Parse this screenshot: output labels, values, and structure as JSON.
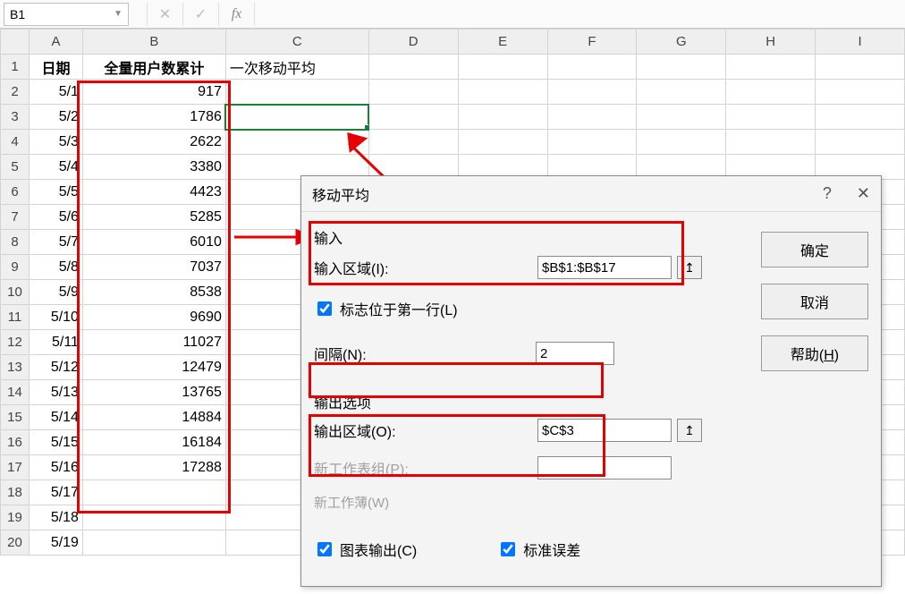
{
  "formula_bar": {
    "namebox": "B1",
    "cancel": "✕",
    "confirm": "✓",
    "fx": "fx"
  },
  "columns": [
    "A",
    "B",
    "C",
    "D",
    "E",
    "F",
    "G",
    "H",
    "I"
  ],
  "row_numbers": [
    "1",
    "2",
    "3",
    "4",
    "5",
    "6",
    "7",
    "8",
    "9",
    "10",
    "11",
    "12",
    "13",
    "14",
    "15",
    "16",
    "17",
    "18",
    "19",
    "20"
  ],
  "headers": {
    "A": "日期",
    "B": "全量用户数累计",
    "C": "一次移动平均"
  },
  "rows": [
    {
      "A": "5/1",
      "B": "917"
    },
    {
      "A": "5/2",
      "B": "1786"
    },
    {
      "A": "5/3",
      "B": "2622"
    },
    {
      "A": "5/4",
      "B": "3380"
    },
    {
      "A": "5/5",
      "B": "4423"
    },
    {
      "A": "5/6",
      "B": "5285"
    },
    {
      "A": "5/7",
      "B": "6010"
    },
    {
      "A": "5/8",
      "B": "7037"
    },
    {
      "A": "5/9",
      "B": "8538"
    },
    {
      "A": "5/10",
      "B": "9690"
    },
    {
      "A": "5/11",
      "B": "11027"
    },
    {
      "A": "5/12",
      "B": "12479"
    },
    {
      "A": "5/13",
      "B": "13765"
    },
    {
      "A": "5/14",
      "B": "14884"
    },
    {
      "A": "5/15",
      "B": "16184"
    },
    {
      "A": "5/16",
      "B": "17288"
    },
    {
      "A": "5/17",
      "B": ""
    },
    {
      "A": "5/18",
      "B": ""
    },
    {
      "A": "5/19",
      "B": ""
    }
  ],
  "dialog": {
    "title": "移动平均",
    "help_q": "?",
    "close_x": "✕",
    "ok": "确定",
    "cancel": "取消",
    "help": "帮助(H)",
    "section_input": "输入",
    "input_range_label": "输入区域(I):",
    "input_range_value": "$B$1:$B$17",
    "labels_first_row": "标志位于第一行(L)",
    "interval_label": "间隔(N):",
    "interval_value": "2",
    "section_output": "输出选项",
    "output_range_label": "输出区域(O):",
    "output_range_value": "$C$3",
    "new_ws_label": "新工作表组(P):",
    "new_wb_label": "新工作薄(W)",
    "chart_out": "图表输出(C)",
    "std_err": "标准误差",
    "picker_glyph": "↥"
  }
}
